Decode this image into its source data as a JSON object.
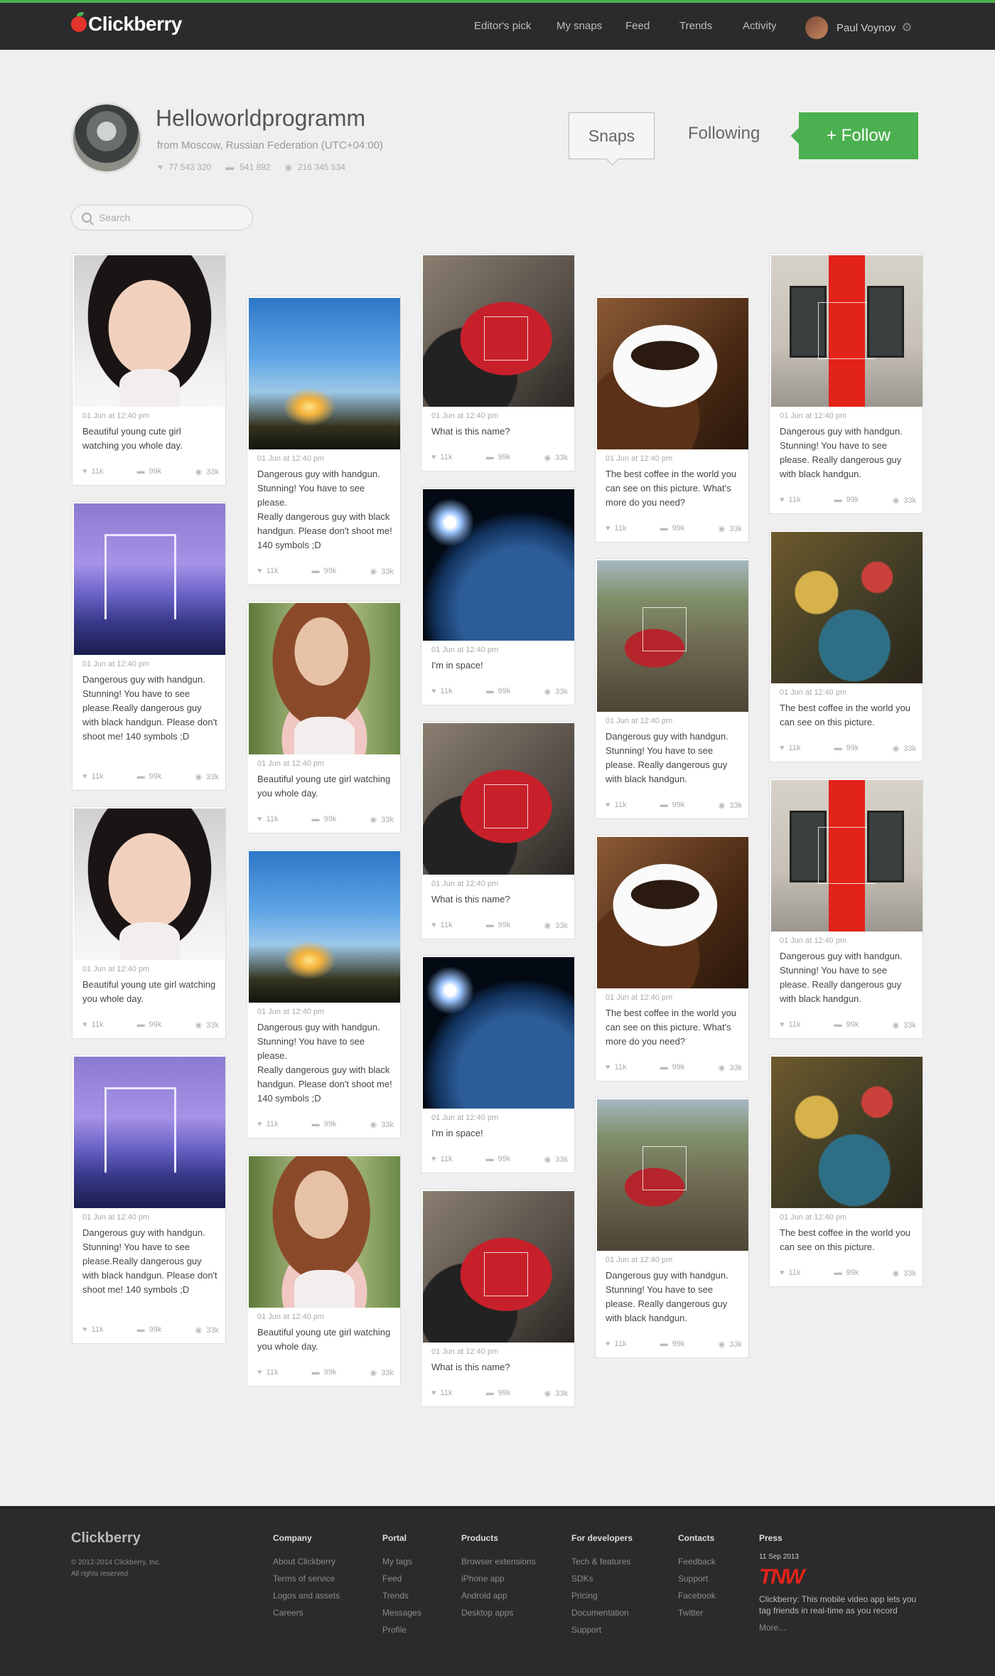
{
  "app": {
    "name": "Clickberry"
  },
  "nav": {
    "items": [
      {
        "label": "Editor's pick"
      },
      {
        "label": "My snaps"
      },
      {
        "label": "Feed"
      },
      {
        "label": "Trends"
      },
      {
        "label": "Activity"
      }
    ],
    "user_name": "Paul Voynov"
  },
  "profile": {
    "name": "Helloworldprogramm",
    "location": "from Moscow, Russian Federation (UTC+04:00)",
    "likes": "77 543 320",
    "comments": "541 892",
    "views": "216 345 534",
    "snaps_label": "Snaps",
    "following_label": "Following",
    "follow_label": "+ Follow"
  },
  "search": {
    "placeholder": "Search"
  },
  "cards": {
    "col1": [
      {
        "date": "01 Jun at 12:40 pm",
        "text": "Beautiful young cute girl watching you whole day.",
        "likes": "11k",
        "comments": "99k",
        "views": "33k",
        "image": "girl"
      },
      {
        "date": "01 Jun at 12:40 pm",
        "text": "Dangerous guy with handgun. Stunning! You have to see please.Really dangerous guy with black handgun. Please don't shoot me! 140 symbols ;D",
        "likes": "11k",
        "comments": "99k",
        "views": "33k",
        "image": "bridge"
      },
      {
        "date": "01 Jun at 12:40 pm",
        "text": "Beautiful young ute girl watching you whole day.",
        "likes": "11k",
        "comments": "99k",
        "views": "33k",
        "image": "girl"
      },
      {
        "date": "01 Jun at 12:40 pm",
        "text": "Dangerous guy with handgun. Stunning! You have to see please.Really dangerous guy with black handgun. Please don't shoot me! 140 symbols ;D",
        "likes": "11k",
        "comments": "99k",
        "views": "33k",
        "image": "bridge"
      }
    ],
    "col2": [
      {
        "date": "01 Jun at 12:40 pm",
        "text": "Dangerous guy with handgun. Stunning! You have to see please.\nReally dangerous guy with black handgun. Please don't shoot me! 140 symbols ;D",
        "likes": "11k",
        "comments": "99k",
        "views": "33k",
        "image": "sky"
      },
      {
        "date": "01 Jun at 12:40 pm",
        "text": "Beautiful young ute girl watching you whole day.",
        "likes": "11k",
        "comments": "99k",
        "views": "33k",
        "image": "redhead"
      },
      {
        "date": "01 Jun at 12:40 pm",
        "text": "Dangerous guy with handgun. Stunning! You have to see please.\nReally dangerous guy with black handgun. Please don't shoot me! 140 symbols ;D",
        "likes": "11k",
        "comments": "99k",
        "views": "33k",
        "image": "sky"
      },
      {
        "date": "01 Jun at 12:40 pm",
        "text": "Beautiful young ute girl watching you whole day.",
        "likes": "11k",
        "comments": "99k",
        "views": "33k",
        "image": "redhead"
      }
    ],
    "col3": [
      {
        "date": "01 Jun at 12:40 pm",
        "text": "What is this name?",
        "likes": "11k",
        "comments": "99k",
        "views": "33k",
        "image": "bike"
      },
      {
        "date": "01 Jun at 12:40 pm",
        "text": "I'm in space!",
        "likes": "11k",
        "comments": "99k",
        "views": "33k",
        "image": "earth"
      },
      {
        "date": "01 Jun at 12:40 pm",
        "text": "What is this name?",
        "likes": "11k",
        "comments": "99k",
        "views": "33k",
        "image": "bike"
      },
      {
        "date": "01 Jun at 12:40 pm",
        "text": "I'm in space!",
        "likes": "11k",
        "comments": "99k",
        "views": "33k",
        "image": "earth"
      },
      {
        "date": "01 Jun at 12:40 pm",
        "text": "What is this name?",
        "likes": "11k",
        "comments": "99k",
        "views": "33k",
        "image": "bike"
      }
    ],
    "col4": [
      {
        "date": "01 Jun at 12:40 pm",
        "text": "The best coffee in the world you can see on this picture. What's more do you need?",
        "likes": "11k",
        "comments": "99k",
        "views": "33k",
        "image": "coffee"
      },
      {
        "date": "01 Jun at 12:40 pm",
        "text": "Dangerous guy with handgun. Stunning! You have to see please. Really dangerous guy with black handgun.",
        "likes": "11k",
        "comments": "99k",
        "views": "33k",
        "image": "car"
      },
      {
        "date": "01 Jun at 12:40 pm",
        "text": "The best coffee in the world you can see on this picture. What's more do you need?",
        "likes": "11k",
        "comments": "99k",
        "views": "33k",
        "image": "coffee"
      },
      {
        "date": "01 Jun at 12:40 pm",
        "text": "Dangerous guy with handgun. Stunning! You have to see please. Really dangerous guy with black handgun.",
        "likes": "11k",
        "comments": "99k",
        "views": "33k",
        "image": "car"
      }
    ],
    "col5": [
      {
        "date": "01 Jun at 12:40 pm",
        "text": "Dangerous guy with handgun. Stunning! You have to see please. Really dangerous guy with black handgun.",
        "likes": "11k",
        "comments": "99k",
        "views": "33k",
        "image": "booth"
      },
      {
        "date": "01 Jun at 12:40 pm",
        "text": "The best coffee in the world you can see on this picture.",
        "likes": "11k",
        "comments": "99k",
        "views": "33k",
        "image": "game"
      },
      {
        "date": "01 Jun at 12:40 pm",
        "text": "Dangerous guy with handgun. Stunning! You have to see please. Really dangerous guy with black handgun.",
        "likes": "11k",
        "comments": "99k",
        "views": "33k",
        "image": "booth"
      },
      {
        "date": "01 Jun at 12:40 pm",
        "text": "The best coffee in the world you can see on this picture.",
        "likes": "11k",
        "comments": "99k",
        "views": "33k",
        "image": "game"
      }
    ]
  },
  "footer": {
    "logo": "Clickberry",
    "copyright": "© 2012-2014 Clickberry, Inc.",
    "rights": "All rights reserved",
    "columns": [
      {
        "title": "Company",
        "links": [
          "About Clickberry",
          "Terms of service",
          "Logos and assets",
          "Careers"
        ]
      },
      {
        "title": "Portal",
        "links": [
          "My tags",
          "Feed",
          "Trends",
          "Messages",
          "Profile"
        ]
      },
      {
        "title": "Products",
        "links": [
          "Browser extensions",
          "iPhone app",
          "Android app",
          "Desktop apps"
        ]
      },
      {
        "title": "For developers",
        "links": [
          "Tech & features",
          "SDKs",
          "Pricing",
          "Documentation",
          "Support"
        ]
      },
      {
        "title": "Contacts",
        "links": [
          "Feedback",
          "Support",
          "Facebook",
          "Twitter"
        ]
      }
    ],
    "press": {
      "title": "Press",
      "date": "11 Sep 2013",
      "logo": "TNW",
      "text": "Clickberry: This mobile video app lets you tag friends in real-time as you record",
      "more": "More..."
    }
  },
  "colors": {
    "accent": "#4bb04f",
    "header": "#2b2b2b",
    "background": "#efefef"
  },
  "icons": [
    "heart-icon",
    "comment-icon",
    "eye-icon",
    "search-icon",
    "gear-icon"
  ]
}
